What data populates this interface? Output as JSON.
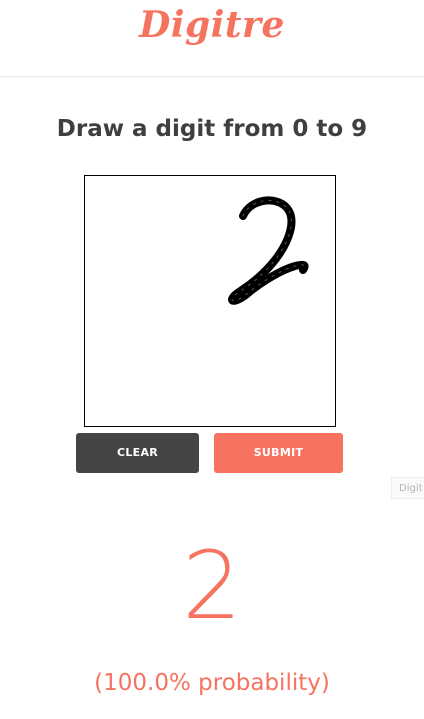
{
  "app": {
    "brand": "Digitre"
  },
  "main": {
    "heading": "Draw a digit from 0 to 9"
  },
  "buttons": {
    "clear_label": "CLEAR",
    "submit_label": "SUBMIT"
  },
  "side_tag": {
    "label": "Digit"
  },
  "result": {
    "digit": "2",
    "probability": "(100.0% probability)"
  },
  "colors": {
    "accent": "#f5735f",
    "clear_button": "#444444",
    "heading_text": "#3f3f3f",
    "stroke": "#000000"
  }
}
